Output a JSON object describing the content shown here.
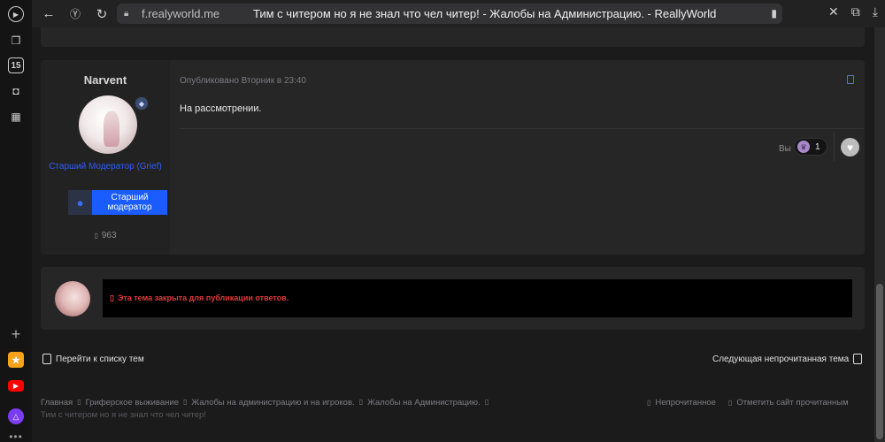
{
  "browser": {
    "url": "f.realyworld.me",
    "page_title": "Тим с читером но я не знал что чел читер! - Жалобы на Администрацию. - ReallyWorld",
    "sidebar_calendar_day": "15",
    "icons": [
      "play-icon",
      "docs-icon",
      "calendar-icon",
      "camera-icon",
      "grid-icon",
      "plus-icon",
      "app-icon",
      "youtube-icon",
      "alice-icon",
      "more-icon"
    ]
  },
  "post": {
    "username": "Narvent",
    "role_title": "Старший Модератор (Grief)",
    "role_badge": "Старший модератор",
    "message_count": "963",
    "published": "Опубликовано Вторник в 23:40",
    "body": "На рассмотрении.",
    "you_label": "Вы",
    "reaction_count": "1"
  },
  "closed_notice": {
    "text": "Эта тема закрыта для публикации ответов."
  },
  "nav": {
    "back_to_list": "Перейти к списку тем",
    "next_unread": "Следующая непрочитанная тема"
  },
  "breadcrumbs": [
    "Главная",
    "Гриферское выживание",
    "Жалобы на администрацию и на игроков.",
    "Жалобы на Администрацию."
  ],
  "footer_thread_title": "Тим с читером но я не знал что чел читер!",
  "quick_links": {
    "unread": "Непрочитанное",
    "mark_read": "Отметить сайт прочитанным"
  }
}
